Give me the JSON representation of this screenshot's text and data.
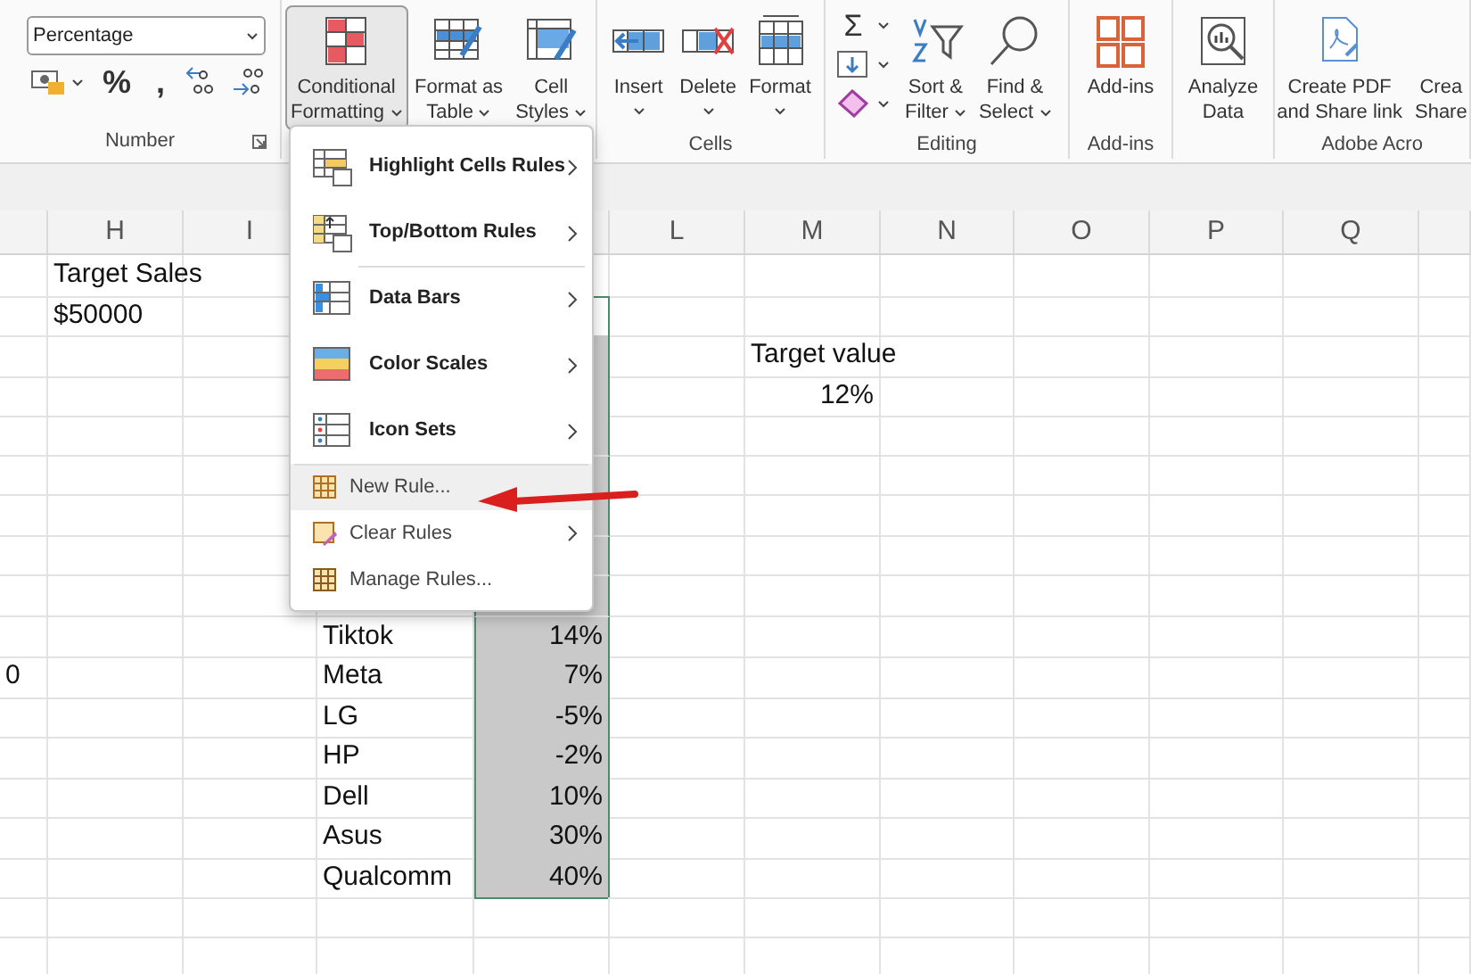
{
  "ribbon": {
    "groups": [
      {
        "label": "Number",
        "launcher": true,
        "format_field": {
          "value": "Percentage"
        },
        "small_buttons": [
          {
            "kind": "accounting",
            "caret": true
          },
          {
            "kind": "text",
            "text": "%"
          },
          {
            "kind": "text",
            "text": ","
          },
          {
            "kind": "increase-decimal",
            "caret": false
          },
          {
            "kind": "decrease-decimal",
            "caret": false
          }
        ]
      },
      {
        "buttons": [
          {
            "lines": [
              "Conditional",
              "Formatting"
            ],
            "caret": true,
            "pressed": true
          },
          {
            "lines": [
              "Format as",
              "Table"
            ],
            "caret": true,
            "pressed": false
          },
          {
            "lines": [
              "Cell",
              "Styles"
            ],
            "caret": true,
            "pressed": false
          }
        ]
      },
      {
        "label": "Cells",
        "buttons": [
          {
            "lines": [
              "Insert"
            ],
            "caret": true,
            "pressed": false
          },
          {
            "lines": [
              "Delete"
            ],
            "caret": true,
            "pressed": false
          },
          {
            "lines": [
              "Format"
            ],
            "caret": true,
            "pressed": false
          }
        ]
      },
      {
        "label": "Editing",
        "stack": [
          {
            "kind": "text",
            "text": "Σ",
            "caret": true
          },
          {
            "kind": "fill",
            "caret": true
          },
          {
            "kind": "eraser",
            "caret": true
          }
        ],
        "buttons": [
          {
            "lines": [
              "Sort &",
              "Filter"
            ],
            "caret": true,
            "pressed": false
          },
          {
            "lines": [
              "Find &",
              "Select"
            ],
            "caret": true,
            "pressed": false
          }
        ]
      },
      {
        "label": "Add-ins",
        "buttons": [
          {
            "lines": [
              "Add-ins"
            ],
            "caret": false,
            "pressed": false
          }
        ]
      },
      {
        "buttons": [
          {
            "lines": [
              "Analyze",
              "Data"
            ],
            "caret": false,
            "pressed": false
          }
        ]
      },
      {
        "label": "Adobe Acro",
        "buttons": [
          {
            "lines": [
              "Create PDF",
              "and Share link"
            ],
            "caret": false,
            "pressed": false
          },
          {
            "lines": [
              "Crea",
              "Share"
            ],
            "caret": false,
            "pressed": false
          }
        ]
      }
    ]
  },
  "menu": {
    "items": [
      {
        "label": "Highlight Cells Rules",
        "bold": true,
        "submenu": true,
        "highlighted": false,
        "separator_before": false
      },
      {
        "label": "Top/Bottom Rules",
        "bold": true,
        "submenu": true,
        "highlighted": false,
        "separator_before": false
      },
      {
        "label": "Data Bars",
        "bold": true,
        "submenu": true,
        "highlighted": false,
        "separator_before": true
      },
      {
        "label": "Color Scales",
        "bold": true,
        "submenu": true,
        "highlighted": false,
        "separator_before": false
      },
      {
        "label": "Icon Sets",
        "bold": true,
        "submenu": true,
        "highlighted": false,
        "separator_before": false
      },
      {
        "label": "New Rule...",
        "bold": false,
        "submenu": false,
        "highlighted": true,
        "separator_before": true
      },
      {
        "label": "Clear Rules",
        "bold": false,
        "submenu": true,
        "highlighted": false,
        "separator_before": false
      },
      {
        "label": "Manage Rules...",
        "bold": false,
        "submenu": false,
        "highlighted": false,
        "separator_before": false
      }
    ]
  },
  "grid": {
    "columns": [
      {},
      {
        "label": "H"
      },
      {
        "label": "I"
      },
      {},
      {},
      {
        "label": "L"
      },
      {
        "label": "M"
      },
      {
        "label": "N"
      },
      {
        "label": "O"
      },
      {
        "label": "P"
      },
      {
        "label": "Q"
      },
      {}
    ],
    "rows": [
      {
        "cells": [
          null,
          {
            "text": "Target Sales",
            "kind": "text"
          }
        ]
      },
      {
        "cells": [
          null,
          {
            "text": "$50000",
            "kind": "text"
          },
          null,
          null,
          {
            "selected": true,
            "active": true
          }
        ]
      },
      {
        "cells": [
          null,
          null,
          null,
          null,
          {
            "selected": true,
            "active": false
          },
          null,
          {
            "text": "Target value",
            "kind": "text"
          }
        ]
      },
      {
        "cells": [
          null,
          null,
          null,
          null,
          {
            "selected": true,
            "active": false
          },
          null,
          {
            "text": "12%",
            "kind": "number"
          }
        ]
      },
      {
        "cells": [
          null,
          null,
          null,
          null,
          {
            "selected": true,
            "active": false
          }
        ]
      },
      {
        "cells": [
          null,
          null,
          null,
          null,
          {
            "selected": true,
            "active": false
          }
        ]
      },
      {
        "cells": [
          null,
          null,
          null,
          null,
          {
            "selected": true,
            "active": false
          }
        ]
      },
      {
        "cells": [
          null,
          null,
          null,
          null,
          {
            "selected": true,
            "active": false
          }
        ]
      },
      {
        "cells": [
          null,
          null,
          null,
          null,
          {
            "selected": true,
            "active": false
          }
        ]
      },
      {
        "cells": [
          null,
          null,
          null,
          {
            "text": "Tiktok",
            "kind": "text"
          },
          {
            "text": "14%",
            "kind": "number",
            "selected": true,
            "active": false
          }
        ]
      },
      {
        "cells": [
          {
            "text": "0",
            "kind": "text"
          },
          null,
          null,
          {
            "text": "Meta",
            "kind": "text"
          },
          {
            "text": "7%",
            "kind": "number",
            "selected": true,
            "active": false
          }
        ]
      },
      {
        "cells": [
          null,
          null,
          null,
          {
            "text": "LG",
            "kind": "text"
          },
          {
            "text": "-5%",
            "kind": "number",
            "selected": true,
            "active": false
          }
        ]
      },
      {
        "cells": [
          null,
          null,
          null,
          {
            "text": "HP",
            "kind": "text"
          },
          {
            "text": "-2%",
            "kind": "number",
            "selected": true,
            "active": false
          }
        ]
      },
      {
        "cells": [
          null,
          null,
          null,
          {
            "text": "Dell",
            "kind": "text"
          },
          {
            "text": "10%",
            "kind": "number",
            "selected": true,
            "active": false
          }
        ]
      },
      {
        "cells": [
          null,
          null,
          null,
          {
            "text": "Asus",
            "kind": "text"
          },
          {
            "text": "30%",
            "kind": "number",
            "selected": true,
            "active": false
          }
        ]
      },
      {
        "cells": [
          null,
          null,
          null,
          {
            "text": "Qualcomm",
            "kind": "text"
          },
          {
            "text": "40%",
            "kind": "number",
            "selected": true,
            "active": false
          }
        ]
      },
      {
        "cells": []
      },
      {
        "cells": []
      }
    ]
  }
}
